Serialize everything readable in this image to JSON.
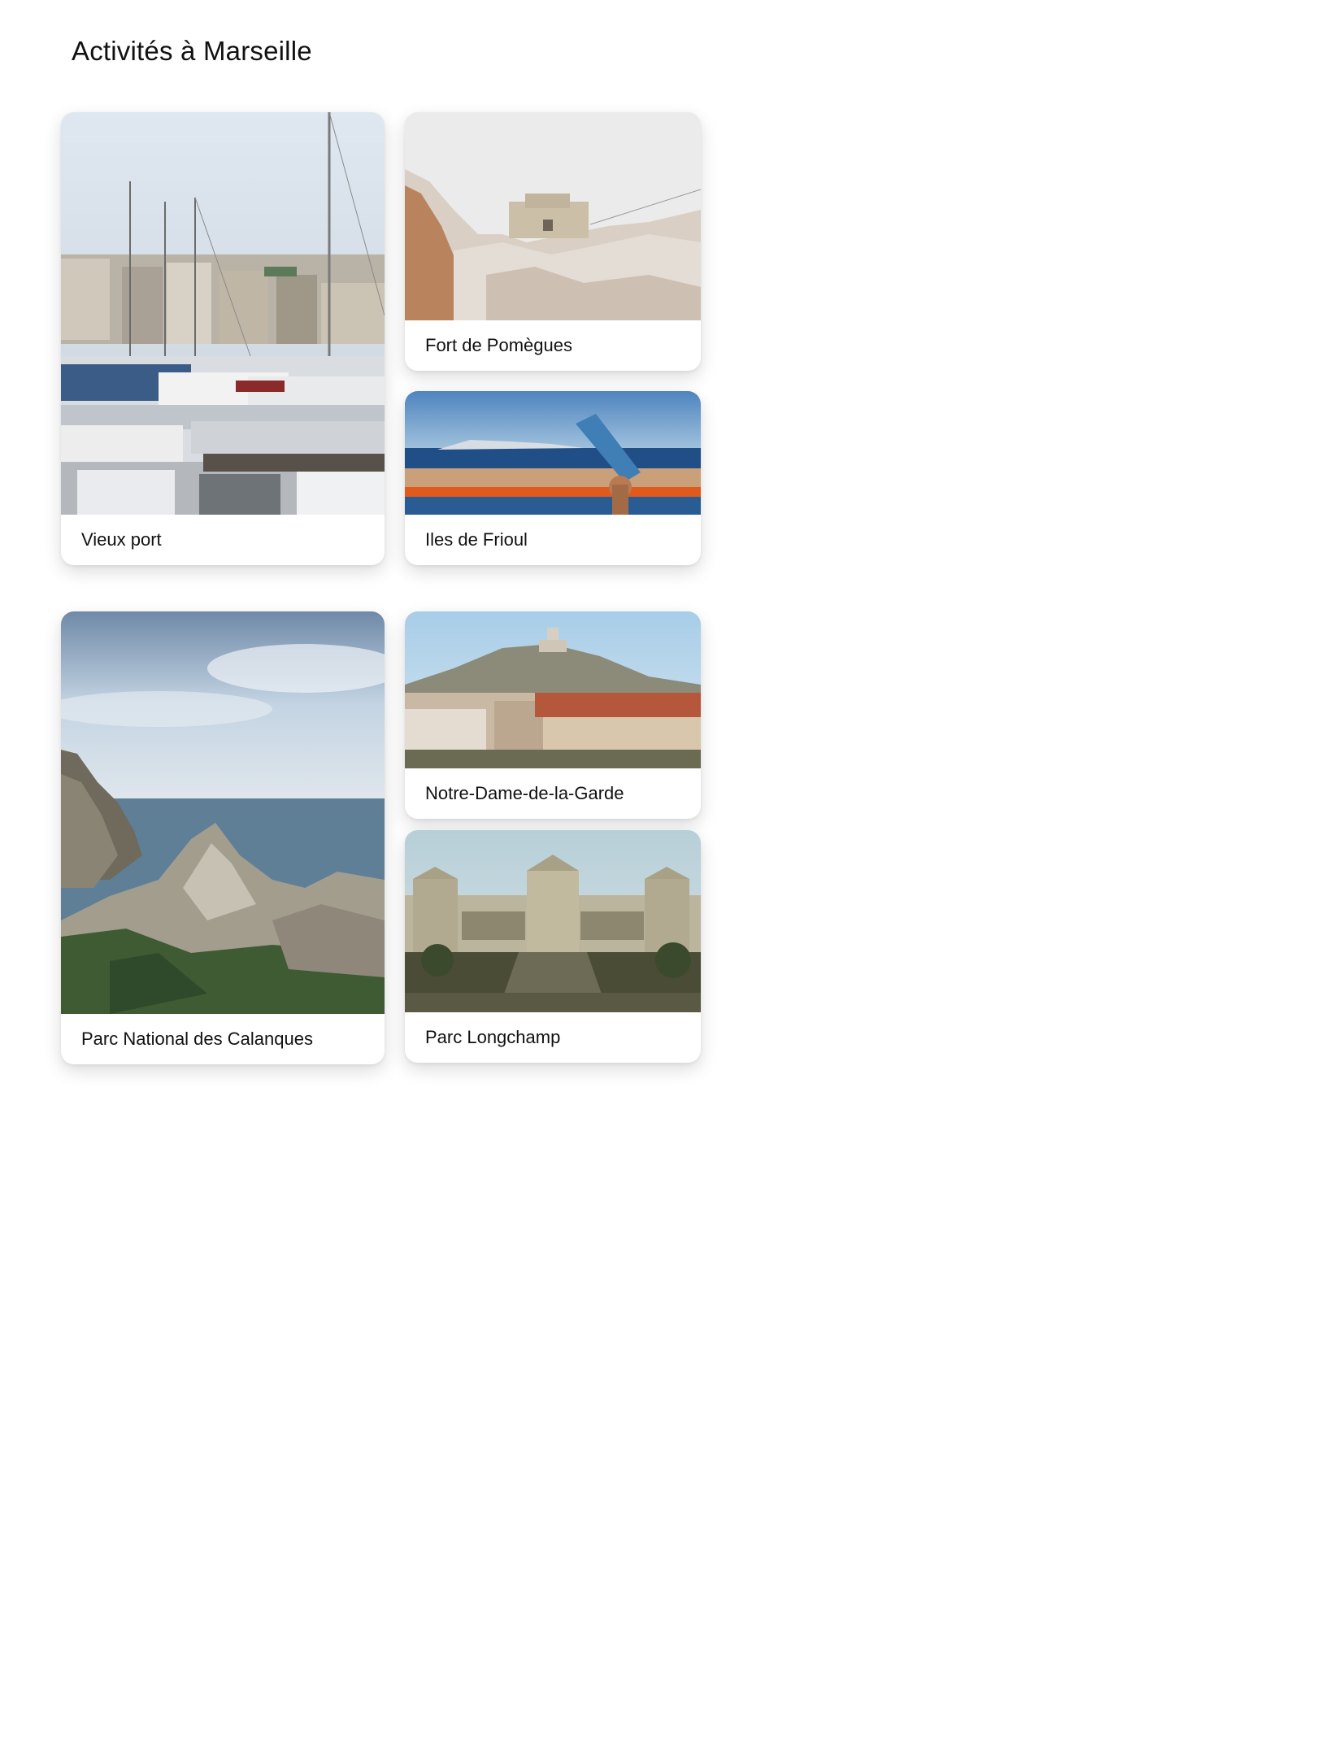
{
  "page": {
    "title": "Activités à Marseille"
  },
  "colors": {
    "background": "#ffffff",
    "text": "#111111",
    "card": "#ffffff"
  },
  "activities": [
    {
      "label": "Vieux port",
      "image": "marina-sailboats-photo"
    },
    {
      "label": "Fort de Pomègues",
      "image": "rocky-fort-photo"
    },
    {
      "label": "Iles de Frioul",
      "image": "sea-islands-telescope-photo"
    },
    {
      "label": "Parc National des Calanques",
      "image": "cliffs-sea-photo"
    },
    {
      "label": "Notre-Dame-de-la-Garde",
      "image": "hilltop-basilica-city-photo"
    },
    {
      "label": "Parc Longchamp",
      "image": "palace-fountain-photo"
    }
  ]
}
